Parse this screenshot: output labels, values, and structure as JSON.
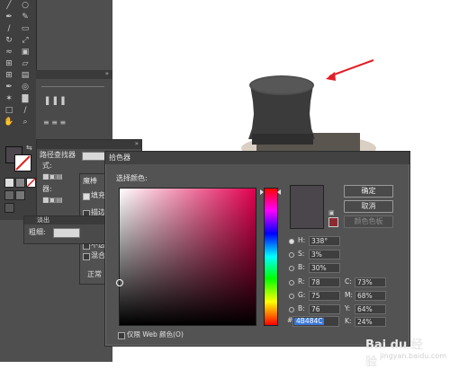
{
  "left_panel": {
    "label_shi": "式:",
    "label_lookup": "路径查找器",
    "label_qi": "器:",
    "label_cubi": "粗细:",
    "label_fade": "淡出",
    "float_tabs": [
      "魔棒"
    ],
    "options": [
      "填充",
      "描边",
      "描边",
      "不透",
      "混合"
    ],
    "label_normal": "正常"
  },
  "dialog": {
    "title": "拾色器",
    "subtitle": "选择颜色:",
    "buttons": {
      "ok": "确定",
      "cancel": "取消",
      "swatches": "颜色色板"
    },
    "hsb": [
      {
        "label": "H:",
        "value": "338°",
        "selected": true
      },
      {
        "label": "S:",
        "value": "3%",
        "selected": false
      },
      {
        "label": "B:",
        "value": "30%",
        "selected": false
      }
    ],
    "rgb": [
      {
        "label": "R:",
        "value": "78"
      },
      {
        "label": "G:",
        "value": "75"
      },
      {
        "label": "B:",
        "value": "76"
      }
    ],
    "cmyk": [
      {
        "label": "C:",
        "value": "73%"
      },
      {
        "label": "M:",
        "value": "68%"
      },
      {
        "label": "Y:",
        "value": "64%"
      },
      {
        "label": "K:",
        "value": "24%"
      }
    ],
    "hex_label": "#",
    "hex_value": "4B484C",
    "web_only_label": "仅限 Web 颜色(O)",
    "current_color": "#4b454c",
    "warning_color": "#8b2a30",
    "hue_accent": "#e2004e"
  },
  "watermark": {
    "logo": "Bai du 经验",
    "url": "jingyan.baidu.com"
  }
}
